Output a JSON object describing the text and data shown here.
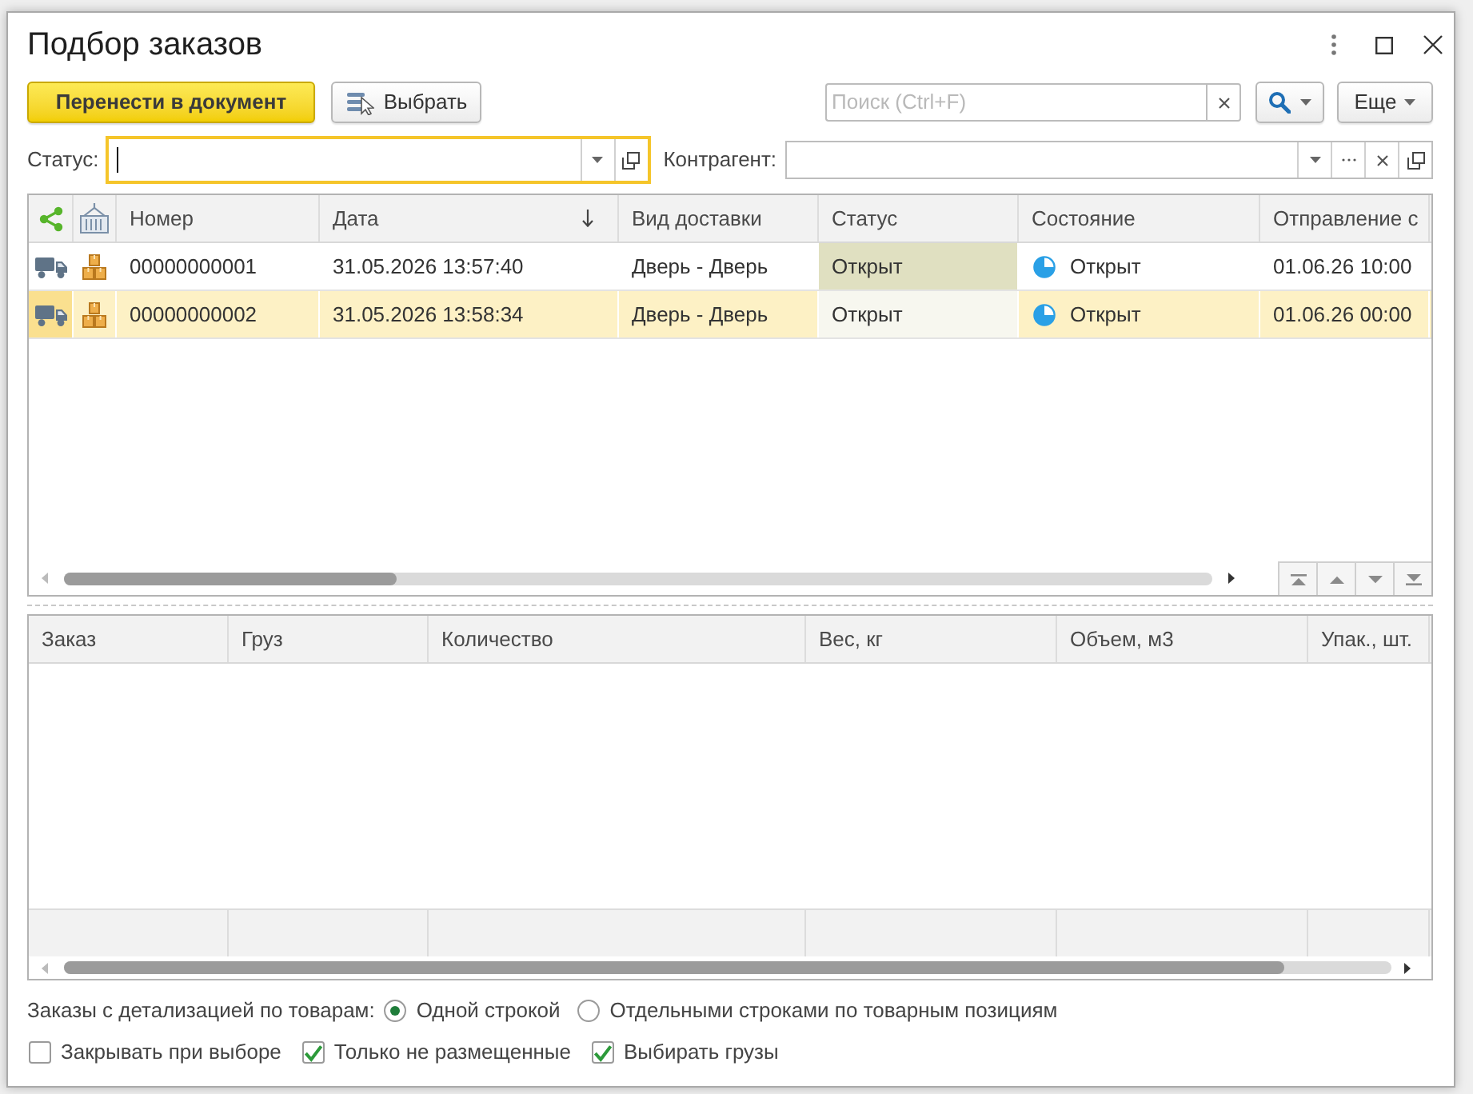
{
  "window": {
    "title": "Подбор заказов"
  },
  "toolbar": {
    "buttons": [
      {
        "kind": "primary",
        "label": "Перенести в документ"
      },
      {
        "kind": "pick",
        "label": "Выбрать"
      }
    ],
    "search": {
      "placeholder": "Поиск (Ctrl+F)"
    },
    "more_button": {
      "label": "Еще"
    }
  },
  "filters": [
    {
      "label": "Статус:",
      "focused": true,
      "buttons": [
        {
          "kind": "dropdown"
        },
        {
          "kind": "open"
        }
      ]
    },
    {
      "label": "Контрагент:",
      "focused": false,
      "buttons": [
        {
          "kind": "dropdown"
        },
        {
          "kind": "select"
        },
        {
          "kind": "clear"
        },
        {
          "kind": "open"
        }
      ]
    }
  ],
  "orders_table": {
    "columns": [
      {
        "kind": "link_icon"
      },
      {
        "kind": "cargo_icon"
      },
      {
        "kind": "text",
        "label": "Номер",
        "sorted": false
      },
      {
        "kind": "text",
        "label": "Дата",
        "sorted": true
      },
      {
        "kind": "text",
        "label": "Вид доставки",
        "sorted": false
      },
      {
        "kind": "text",
        "label": "Статус",
        "sorted": false
      },
      {
        "kind": "text",
        "label": "Состояние",
        "sorted": false
      },
      {
        "kind": "text",
        "label": "Отправление с",
        "sorted": false
      }
    ],
    "rows": [
      {
        "selected": false,
        "cells": [
          {
            "kind": "truck"
          },
          {
            "kind": "boxes"
          },
          {
            "kind": "text",
            "text": "00000000001"
          },
          {
            "kind": "text",
            "text": "31.05.2026 13:57:40"
          },
          {
            "kind": "text",
            "text": "Дверь - Дверь"
          },
          {
            "kind": "status",
            "text": "Открыт",
            "color": "#e0e0c1"
          },
          {
            "kind": "state",
            "text": "Открыт"
          },
          {
            "kind": "text",
            "text": "01.06.26 10:00"
          }
        ]
      },
      {
        "selected": true,
        "cells": [
          {
            "kind": "truck"
          },
          {
            "kind": "boxes"
          },
          {
            "kind": "text",
            "text": "00000000002"
          },
          {
            "kind": "text",
            "text": "31.05.2026 13:58:34"
          },
          {
            "kind": "text",
            "text": "Дверь - Дверь"
          },
          {
            "kind": "status",
            "text": "Открыт",
            "color": "#f7f7ef"
          },
          {
            "kind": "state",
            "text": "Открыт"
          },
          {
            "kind": "text",
            "text": "01.06.26 00:00"
          }
        ]
      }
    ]
  },
  "details_table": {
    "columns": [
      "Заказ",
      "Груз",
      "Количество",
      "Вес, кг",
      "Объем, м3",
      "Упак., шт."
    ]
  },
  "detail_mode": {
    "label": "Заказы с детализацией по товарам:",
    "options": [
      {
        "label": "Одной строкой",
        "selected": true
      },
      {
        "label": "Отдельными строками по товарным позициям",
        "selected": false
      }
    ]
  },
  "checkboxes": [
    {
      "label": "Закрывать при выборе",
      "checked": false
    },
    {
      "label": "Только не размещенные",
      "checked": true
    },
    {
      "label": "Выбирать грузы",
      "checked": true
    }
  ]
}
